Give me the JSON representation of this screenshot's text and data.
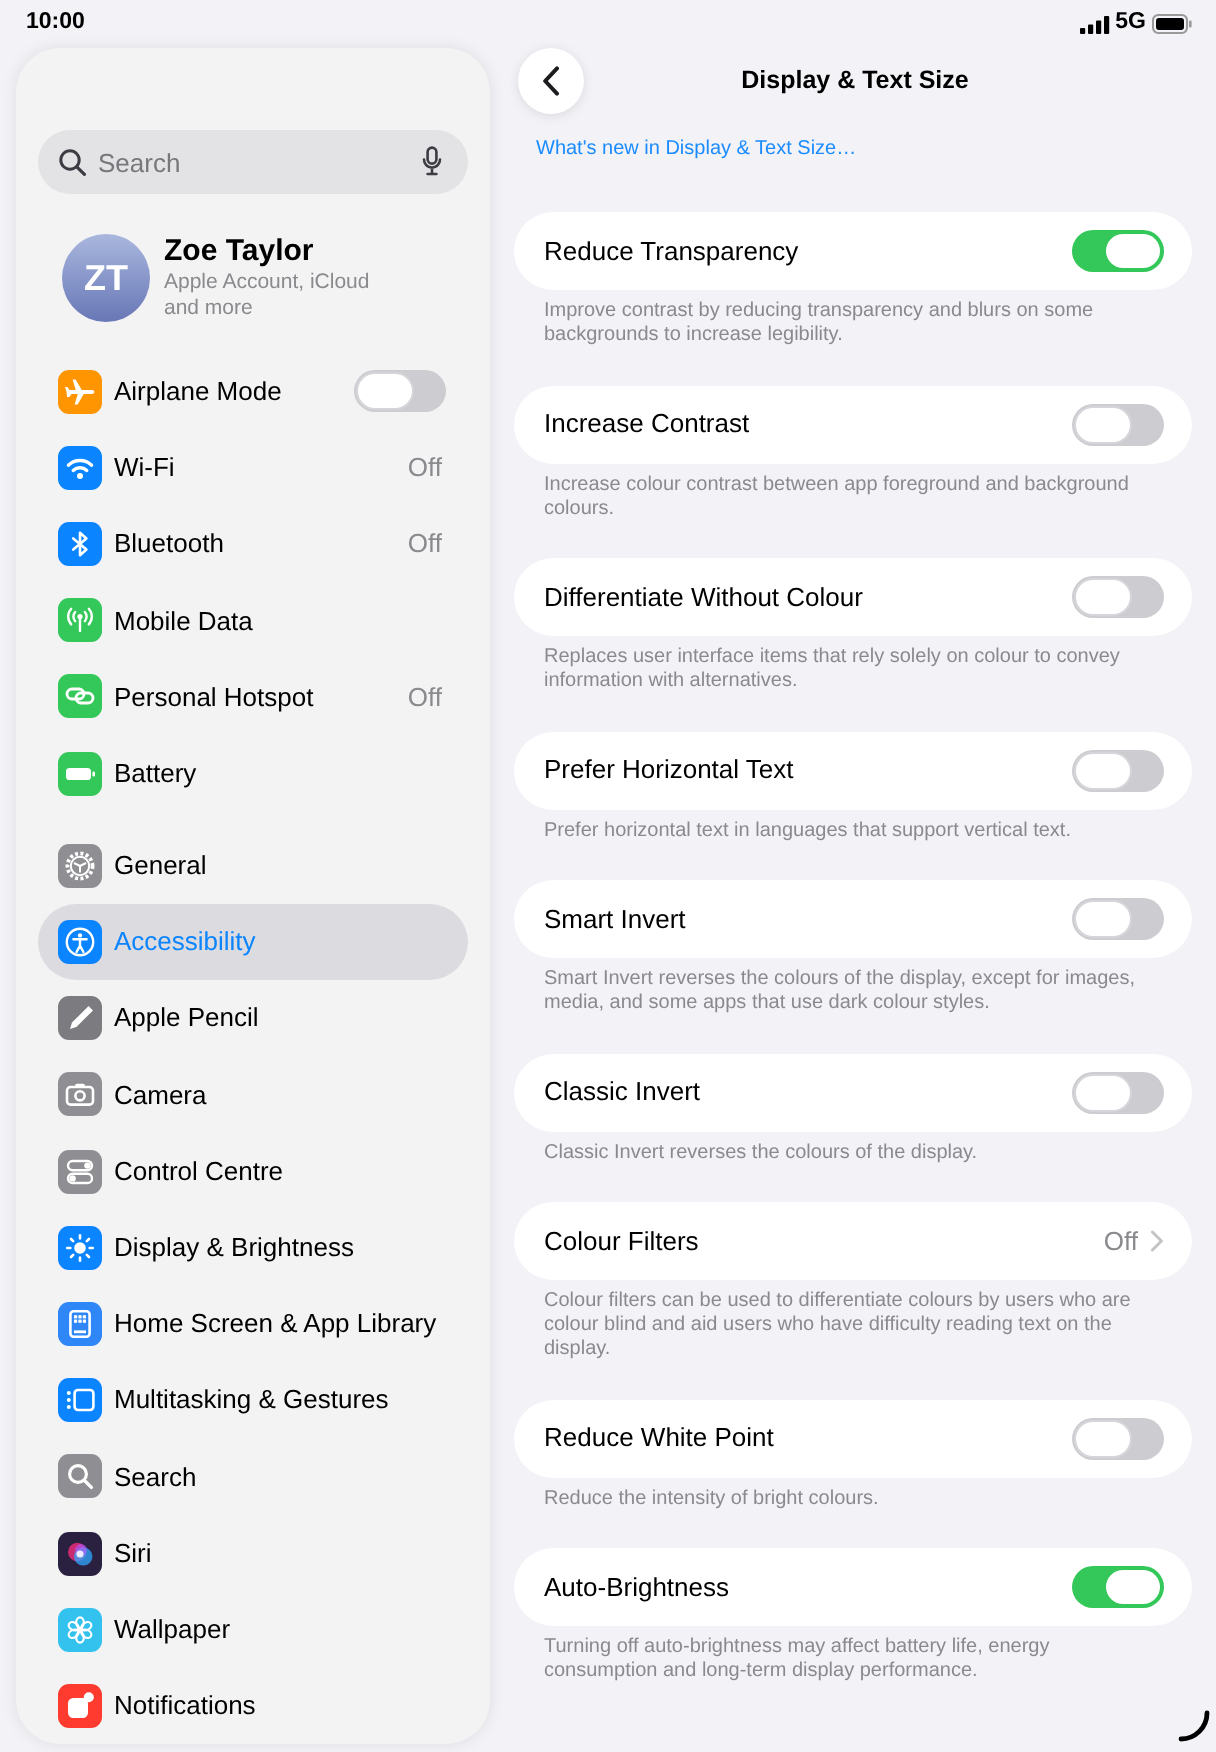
{
  "status_bar": {
    "time": "10:00",
    "network": "5G"
  },
  "sidebar": {
    "search": {
      "placeholder": "Search"
    },
    "account": {
      "initials": "ZT",
      "name": "Zoe Taylor",
      "subtitle": "Apple Account, iCloud and more"
    },
    "groups": [
      {
        "items": [
          {
            "label": "Airplane Mode",
            "kind": "toggle",
            "on": false,
            "color": "#ff9500",
            "selected": false
          },
          {
            "label": "Wi-Fi",
            "kind": "value",
            "value": "Off",
            "color": "#0a84ff",
            "selected": false
          },
          {
            "label": "Bluetooth",
            "kind": "value",
            "value": "Off",
            "color": "#0a84ff",
            "selected": false
          },
          {
            "label": "Mobile Data",
            "kind": "plain",
            "color": "#34c759",
            "selected": false
          },
          {
            "label": "Personal Hotspot",
            "kind": "value",
            "value": "Off",
            "color": "#34c759",
            "selected": false
          },
          {
            "label": "Battery",
            "kind": "plain",
            "color": "#34c759",
            "selected": false
          }
        ]
      },
      {
        "items": [
          {
            "label": "General",
            "kind": "plain",
            "color": "#8e8e93",
            "selected": false
          },
          {
            "label": "Accessibility",
            "kind": "plain",
            "color": "#0a84ff",
            "selected": true
          },
          {
            "label": "Apple Pencil",
            "kind": "plain",
            "color": "#7c7c80",
            "selected": false
          },
          {
            "label": "Camera",
            "kind": "plain",
            "color": "#8e8e93",
            "selected": false
          },
          {
            "label": "Control Centre",
            "kind": "plain",
            "color": "#8e8e93",
            "selected": false
          },
          {
            "label": "Display & Brightness",
            "kind": "plain",
            "color": "#0a84ff",
            "selected": false
          },
          {
            "label": "Home Screen & App Library",
            "kind": "plain",
            "color": "#2f86f6",
            "selected": false
          },
          {
            "label": "Multitasking & Gestures",
            "kind": "plain",
            "color": "#0a84ff",
            "selected": false
          },
          {
            "label": "Search",
            "kind": "plain",
            "color": "#8e8e93",
            "selected": false
          },
          {
            "label": "Siri",
            "kind": "plain",
            "color": "#2a2140",
            "selected": false
          },
          {
            "label": "Wallpaper",
            "kind": "plain",
            "color": "#33c2ee",
            "selected": false
          },
          {
            "label": "Notifications",
            "kind": "plain",
            "color": "#ff3b30",
            "selected": false
          }
        ]
      }
    ]
  },
  "detail": {
    "title": "Display & Text Size",
    "link": "What's new in Display & Text Size…",
    "settings": [
      {
        "label": "Reduce Transparency",
        "kind": "toggle",
        "on": true,
        "description": "Improve contrast by reducing transparency and blurs on some backgrounds to increase legibility."
      },
      {
        "label": "Increase Contrast",
        "kind": "toggle",
        "on": false,
        "description": "Increase colour contrast between app foreground and background colours."
      },
      {
        "label": "Differentiate Without Colour",
        "kind": "toggle",
        "on": false,
        "description": "Replaces user interface items that rely solely on colour to convey information with alternatives."
      },
      {
        "label": "Prefer Horizontal Text",
        "kind": "toggle",
        "on": false,
        "description": "Prefer horizontal text in languages that support vertical text."
      },
      {
        "label": "Smart Invert",
        "kind": "toggle",
        "on": false,
        "description": "Smart Invert reverses the colours of the display, except for images, media, and some apps that use dark colour styles."
      },
      {
        "label": "Classic Invert",
        "kind": "toggle",
        "on": false,
        "description": "Classic Invert reverses the colours of the display."
      },
      {
        "label": "Colour Filters",
        "kind": "disclosure",
        "value": "Off",
        "description": "Colour filters can be used to differentiate colours by users who are colour blind and aid users who have difficulty reading text on the display."
      },
      {
        "label": "Reduce White Point",
        "kind": "toggle",
        "on": false,
        "description": "Reduce the intensity of bright colours."
      },
      {
        "label": "Auto-Brightness",
        "kind": "toggle",
        "on": true,
        "description": "Turning off auto-brightness may affect battery life, energy consumption and long-term display performance."
      }
    ]
  }
}
